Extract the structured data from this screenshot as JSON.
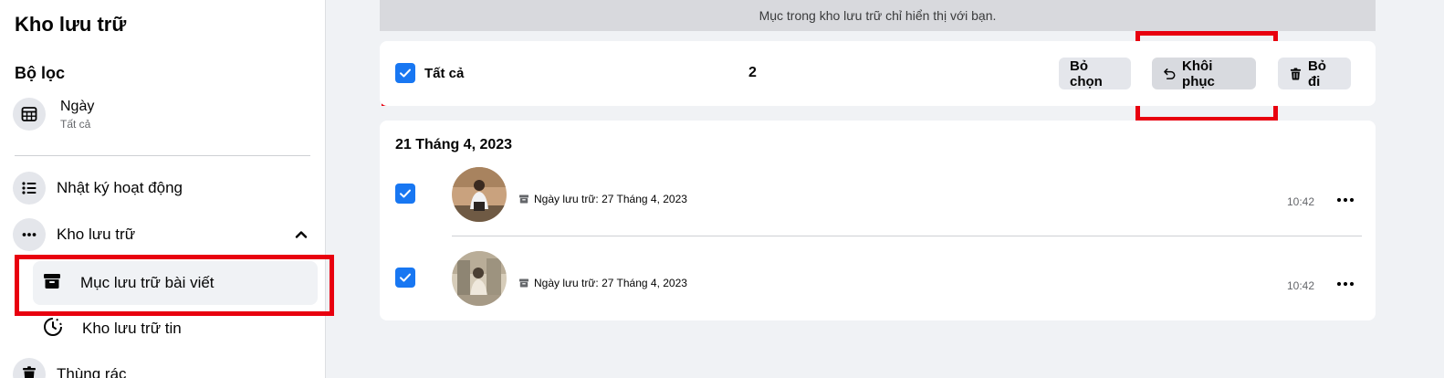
{
  "sidebar": {
    "title": "Kho lưu trữ",
    "filter_heading": "Bộ lọc",
    "date_filter": {
      "label": "Ngày",
      "value": "Tất cả",
      "icon": "calendar-icon"
    },
    "nav": {
      "activity_log": {
        "label": "Nhật ký hoạt động",
        "icon": "list-icon"
      },
      "archive": {
        "label": "Kho lưu trữ",
        "icon": "more-icon",
        "expanded": true
      },
      "post_archive": {
        "label": "Mục lưu trữ bài viết",
        "icon": "archive-box-icon",
        "selected": true
      },
      "story_archive": {
        "label": "Kho lưu trữ tin",
        "icon": "clock-history-icon"
      },
      "trash": {
        "label": "Thùng rác",
        "icon": "trash-icon"
      }
    }
  },
  "main": {
    "privacy_banner": "Mục trong kho lưu trữ chỉ hiển thị với bạn.",
    "toolbar": {
      "select_all_label": "Tất cả",
      "select_all_checked": true,
      "selected_count": "2",
      "deselect_label": "Bỏ chọn",
      "restore_label": "Khôi phục",
      "remove_label": "Bỏ đi"
    },
    "group_date": "21 Tháng 4, 2023",
    "items": [
      {
        "checked": true,
        "meta": "Ngày lưu trữ: 27 Tháng 4, 2023",
        "time": "10:42"
      },
      {
        "checked": true,
        "meta": "Ngày lưu trữ: 27 Tháng 4, 2023",
        "time": "10:42"
      }
    ]
  },
  "colors": {
    "accent": "#1877f2",
    "highlight_box": "#e8000f",
    "button_bg": "#e4e6eb",
    "page_bg": "#f0f2f5"
  }
}
